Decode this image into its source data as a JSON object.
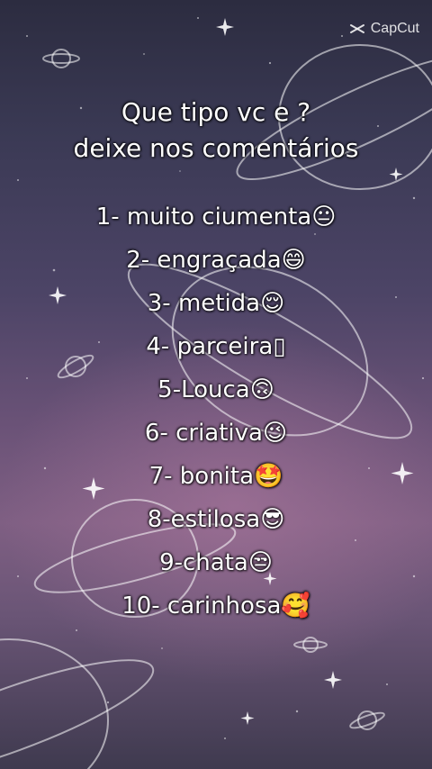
{
  "watermark": {
    "label": "CapCut",
    "icon": "capcut-logo-icon"
  },
  "title": {
    "line1": "Que tipo vc e ?",
    "line2": "deixe nos comentários"
  },
  "items": [
    {
      "text": "1- muito ciumenta",
      "emoji": "😐"
    },
    {
      "text": "2- engraçada",
      "emoji": "😄"
    },
    {
      "text": "3- metida",
      "emoji": "😌"
    },
    {
      "text": "4- parceira",
      "emoji": "▯"
    },
    {
      "text": "5-Louca",
      "emoji": "🙃"
    },
    {
      "text": "6- criativa",
      "emoji": "😉"
    },
    {
      "text": "7- bonita",
      "emoji": "🤩"
    },
    {
      "text": "8-estilosa",
      "emoji": "😎"
    },
    {
      "text": "9-chata",
      "emoji": "😒"
    },
    {
      "text": "10- carinhosa",
      "emoji": "🥰"
    }
  ]
}
